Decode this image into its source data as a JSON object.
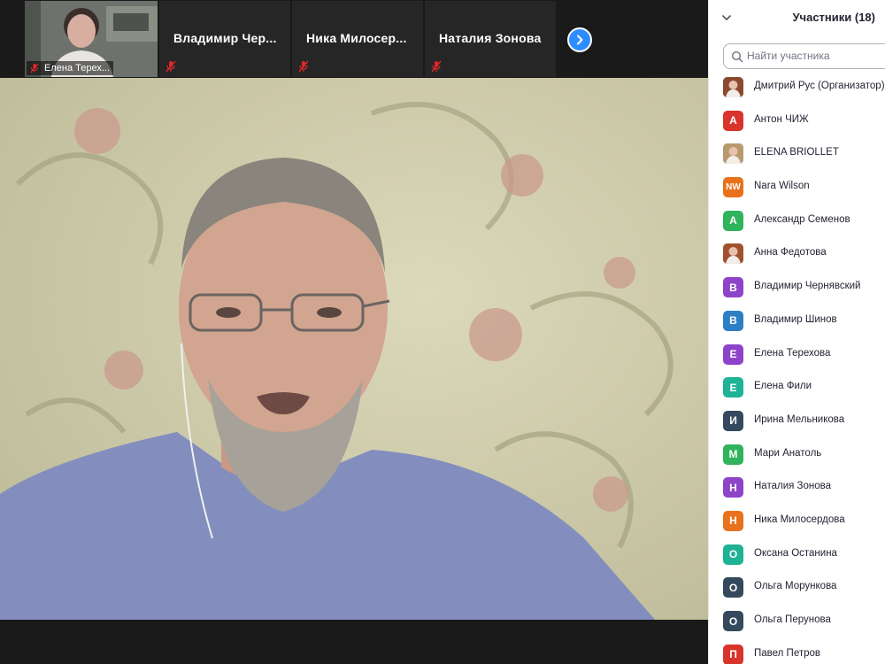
{
  "thumbnails": [
    {
      "name": "Елена Терех...",
      "type": "video",
      "muted": true
    },
    {
      "name": "Владимир  Чер...",
      "type": "name",
      "muted": true
    },
    {
      "name": "Ника  Милосер...",
      "type": "name",
      "muted": true
    },
    {
      "name": "Наталия Зонова",
      "type": "name",
      "muted": true
    }
  ],
  "participants_panel": {
    "title": "Участники (18)",
    "search_placeholder": "Найти участника",
    "participants": [
      {
        "name": "Дмитрий Рус (Организатор)",
        "initials": "",
        "color": "#8b4a2f",
        "photo": true
      },
      {
        "name": "Антон ЧИЖ",
        "initials": "А",
        "color": "#d9342b"
      },
      {
        "name": "ELENA BRIOLLET",
        "initials": "",
        "color": "#b79a6e",
        "photo": true
      },
      {
        "name": "Nara Wilson",
        "initials": "NW",
        "color": "#e8721c"
      },
      {
        "name": "Александр Семенов",
        "initials": "А",
        "color": "#2fb35c"
      },
      {
        "name": "Анна Федотова",
        "initials": "",
        "color": "#a0522d",
        "photo": true
      },
      {
        "name": "Владимир Чернявский",
        "initials": "В",
        "color": "#8e44c9"
      },
      {
        "name": "Владимир Шинов",
        "initials": "В",
        "color": "#2d7fc4"
      },
      {
        "name": "Елена Терехова",
        "initials": "Е",
        "color": "#8e44c9"
      },
      {
        "name": "Елена Фили",
        "initials": "Е",
        "color": "#1fb295"
      },
      {
        "name": "Ирина Мельникова",
        "initials": "И",
        "color": "#34495e"
      },
      {
        "name": "Мари Анатоль",
        "initials": "М",
        "color": "#2fb35c"
      },
      {
        "name": "Наталия Зонова",
        "initials": "Н",
        "color": "#8e44c9"
      },
      {
        "name": "Ника Милосердова",
        "initials": "Н",
        "color": "#e8721c"
      },
      {
        "name": "Оксана Останина",
        "initials": "О",
        "color": "#1fb295"
      },
      {
        "name": "Ольга Морункова",
        "initials": "О",
        "color": "#34495e"
      },
      {
        "name": "Ольга Перунова",
        "initials": "О",
        "color": "#34495e"
      },
      {
        "name": "Павел Петров",
        "initials": "П",
        "color": "#d9342b"
      }
    ]
  },
  "colors": {
    "accent": "#2d8cff",
    "muted_mic": "#e02828"
  }
}
